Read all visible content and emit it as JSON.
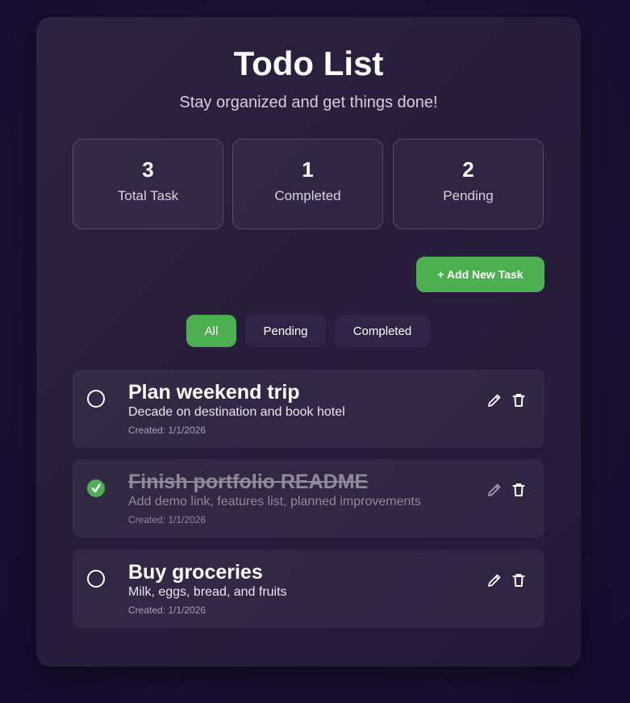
{
  "app": {
    "title": "Todo List",
    "subtitle": "Stay organized and get things done!"
  },
  "stats": [
    {
      "value": "3",
      "label": "Total Task"
    },
    {
      "value": "1",
      "label": "Completed"
    },
    {
      "value": "2",
      "label": "Pending"
    }
  ],
  "actions": {
    "add_task_label": "+ Add New Task"
  },
  "filters": {
    "all": "All",
    "pending": "Pending",
    "completed": "Completed",
    "active": "All"
  },
  "tasks": [
    {
      "title": "Plan weekend trip",
      "description": "Decade on destination and book hotel",
      "created": "Created: 1/1/2026",
      "completed": false
    },
    {
      "title": "Finish portfolio README",
      "description": "Add demo link, features list, planned improvements",
      "created": "Created: 1/1/2026",
      "completed": true
    },
    {
      "title": "Buy groceries",
      "description": "Milk, eggs, bread, and fruits",
      "created": "Created: 1/1/2026",
      "completed": false
    }
  ],
  "colors": {
    "accent": "#4caf50",
    "card_background": "#2a1f3d",
    "page_background": "#1a1230",
    "muted_text": "#8f8a98"
  },
  "icons": {
    "edit": "pencil-icon",
    "delete": "trash-icon",
    "unchecked": "circle-outline-icon",
    "checked": "checkmark-circle-icon"
  }
}
